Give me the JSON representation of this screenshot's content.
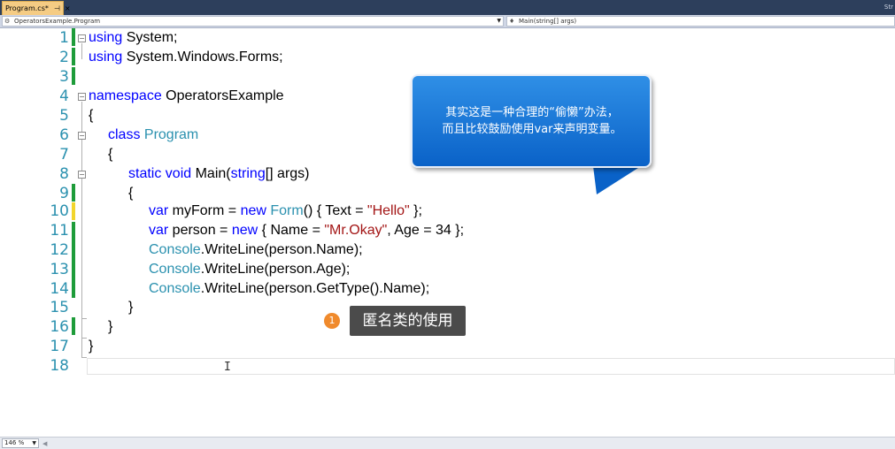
{
  "tab": {
    "label": "Program.cs*",
    "pin": "⊣",
    "close": "×"
  },
  "tab_right": "Str",
  "nav": {
    "left": "OperatorsExample.Program",
    "right": "Main(string[] args)"
  },
  "code": {
    "line_numbers": [
      "1",
      "2",
      "3",
      "4",
      "5",
      "6",
      "7",
      "8",
      "9",
      "10",
      "11",
      "12",
      "13",
      "14",
      "15",
      "16",
      "17",
      "18"
    ],
    "l1_kw": "using",
    "l1_rest": " System;",
    "l2_kw": "using",
    "l2_rest": " System.Windows.Forms;",
    "l4_kw": "namespace",
    "l4_rest": " OperatorsExample",
    "l5": "{",
    "l6_kw": "class",
    "l6_type": " Program",
    "l7": "{",
    "l8_kw1": "static",
    "l8_kw2": " void",
    "l8_mid": " Main(",
    "l8_kw3": "string",
    "l8_rest": "[] args)",
    "l9": "{",
    "l10_kw": "var",
    "l10_a": " myForm = ",
    "l10_kw2": "new",
    "l10_type": " Form",
    "l10_b": "() { Text = ",
    "l10_str": "\"Hello\"",
    "l10_c": " };",
    "l11_kw": "var",
    "l11_a": " person = ",
    "l11_kw2": "new",
    "l11_b": " { Name = ",
    "l11_str": "\"Mr.Okay\"",
    "l11_c": ", Age = 34 };",
    "l12_type": "Console",
    "l12_rest": ".WriteLine(person.Name);",
    "l13_type": "Console",
    "l13_rest": ".WriteLine(person.Age);",
    "l14_type": "Console",
    "l14_rest": ".WriteLine(person.GetType().Name);",
    "l15": "}",
    "l16": "}",
    "l17": "}"
  },
  "callout": {
    "line1": "其实这是一种合理的“偷懒”办法，",
    "line2": "而且比较鼓励使用var来声明变量。"
  },
  "badge": {
    "number": "1",
    "label": "匿名类的使用"
  },
  "zoom": {
    "value": "146 %"
  },
  "colors": {
    "keyword": "#0000ff",
    "type": "#2b91af",
    "string": "#a31515",
    "saved_bar": "#1e9c3a",
    "unsaved_bar": "#f2d52c"
  }
}
